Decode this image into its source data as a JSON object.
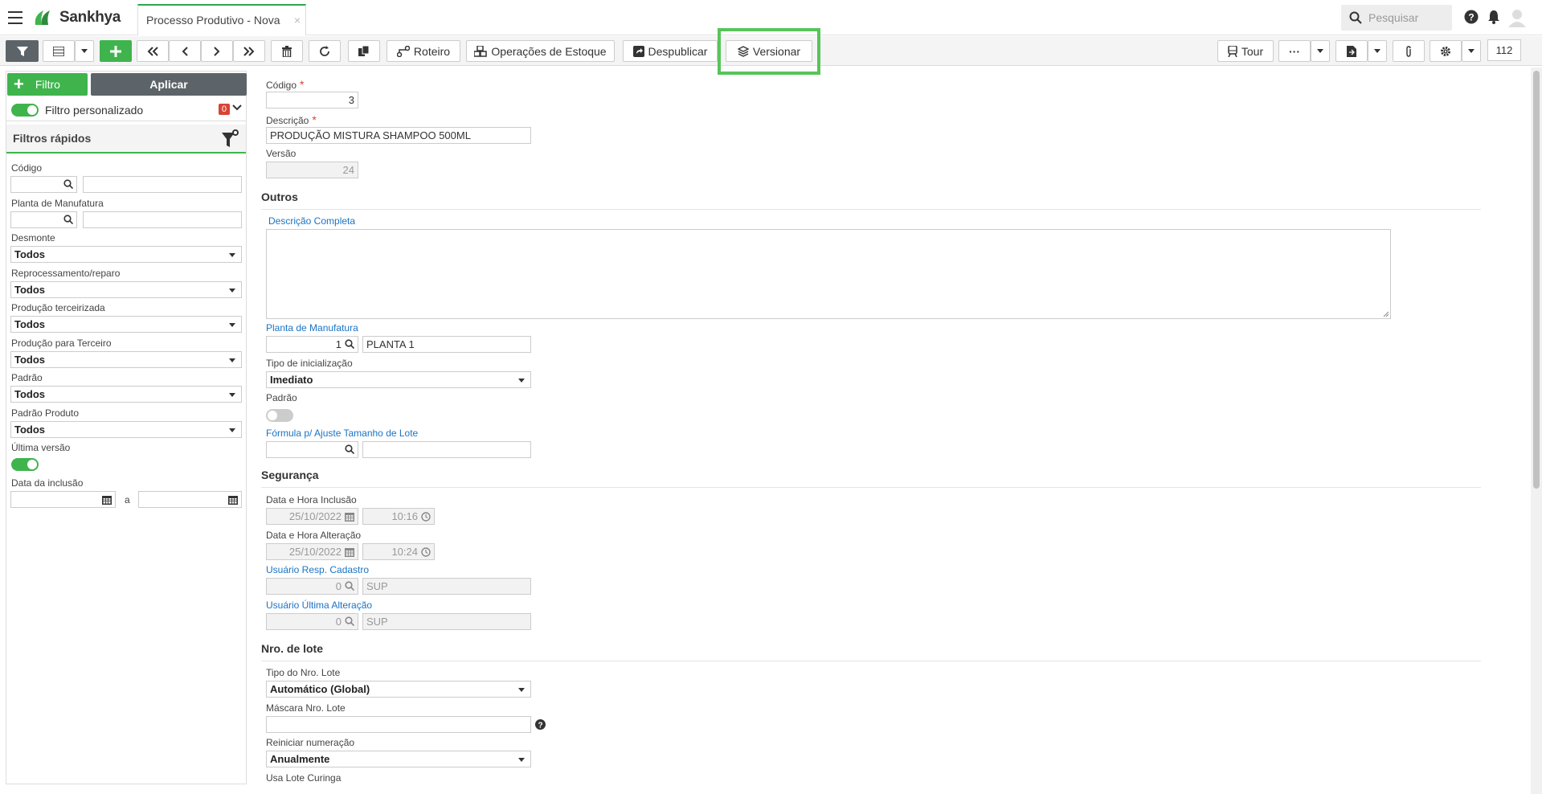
{
  "app": {
    "brand": "Sankhya",
    "tab_title": "Processo Produtivo - Nova",
    "tab_close": "×",
    "search_placeholder": "Pesquisar"
  },
  "toolbar": {
    "roteiro": "Roteiro",
    "operacoes": "Operações de Estoque",
    "despublicar": "Despublicar",
    "versionar": "Versionar",
    "tour": "Tour",
    "more": "···",
    "counter": "112"
  },
  "sidebar": {
    "filtro_btn": "Filtro",
    "filtro_plus": "+",
    "aplicar": "Aplicar",
    "filtro_personalizado": "Filtro personalizado",
    "badge": "0",
    "filtros_rapidos": "Filtros rápidos",
    "codigo": "Código",
    "planta": "Planta de Manufatura",
    "desmonte": "Desmonte",
    "desmonte_val": "Todos",
    "reproc": "Reprocessamento/reparo",
    "reproc_val": "Todos",
    "terceirizada": "Produção terceirizada",
    "terceirizada_val": "Todos",
    "para_terceiro": "Produção para Terceiro",
    "para_terceiro_val": "Todos",
    "padrao": "Padrão",
    "padrao_val": "Todos",
    "padrao_produto": "Padrão Produto",
    "padrao_produto_val": "Todos",
    "ultima_versao": "Última versão",
    "data_inclusao": "Data da inclusão",
    "a": "a"
  },
  "form": {
    "codigo_label": "Código",
    "codigo_req": "*",
    "codigo_val": "3",
    "descricao_label": "Descrição",
    "descricao_req": "*",
    "descricao_val": "PRODUÇÃO MISTURA SHAMPOO 500ML",
    "versao_label": "Versão",
    "versao_val": "24",
    "outros": "Outros",
    "descricao_completa": "Descrição Completa",
    "planta_label": "Planta de Manufatura",
    "planta_cod": "1",
    "planta_nome": "PLANTA 1",
    "tipo_init_label": "Tipo de inicialização",
    "tipo_init_val": "Imediato",
    "padrao_label": "Padrão",
    "formula_label": "Fórmula p/ Ajuste Tamanho de Lote",
    "seguranca": "Segurança",
    "dh_inclusao_label": "Data e Hora Inclusão",
    "dh_inclusao_data": "25/10/2022",
    "dh_inclusao_hora": "10:16",
    "dh_alteracao_label": "Data e Hora Alteração",
    "dh_alteracao_data": "25/10/2022",
    "dh_alteracao_hora": "10:24",
    "usr_cad_label": "Usuário Resp. Cadastro",
    "usr_cad_cod": "0",
    "usr_cad_nome": "SUP",
    "usr_alt_label": "Usuário Última Alteração",
    "usr_alt_cod": "0",
    "usr_alt_nome": "SUP",
    "nro_lote": "Nro. de lote",
    "tipo_lote_label": "Tipo do Nro. Lote",
    "tipo_lote_val": "Automático (Global)",
    "mascara_label": "Máscara Nro. Lote",
    "reiniciar_label": "Reiniciar numeração",
    "reiniciar_val": "Anualmente",
    "lote_curinga_label": "Usa Lote Curinga"
  }
}
